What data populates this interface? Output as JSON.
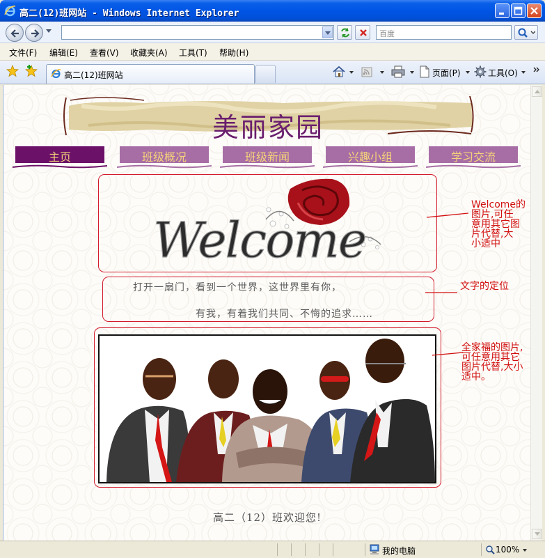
{
  "window": {
    "title": "高二(12)班网站 - Windows Internet Explorer"
  },
  "toolbar": {
    "address": "",
    "search_placeholder": "百度"
  },
  "menu": {
    "items": [
      "文件(F)",
      "编辑(E)",
      "查看(V)",
      "收藏夹(A)",
      "工具(T)",
      "帮助(H)"
    ]
  },
  "tab": {
    "label": "高二(12)班网站"
  },
  "commands": {
    "page": "页面(P)",
    "tools": "工具(O)"
  },
  "page": {
    "banner_title": "美丽家园",
    "nav": [
      "主页",
      "班级概况",
      "班级新闻",
      "兴趣小组",
      "学习交流"
    ],
    "welcome_word": "Welcome",
    "quote_line1": "打开一扇门，看到一个世界，这世界里有你，",
    "quote_line2": "有我，有着我们共同、不悔的追求……",
    "footer": "高二（12）班欢迎您!",
    "annotations": {
      "welcome": [
        "Welcome的",
        "图片,可任",
        "意用其它图",
        "片代替,大",
        "小适中"
      ],
      "text_position": "文字的定位",
      "group_photo": [
        "全家福的图片,",
        "可任意用其它",
        "图片代替,大小",
        "适中。"
      ]
    }
  },
  "status": {
    "zone": "我的电脑",
    "zoom": "100%"
  },
  "colors": {
    "nav_active": "#6c1168",
    "nav_inactive": "#a76ea5",
    "nav_text": "#f2d27a",
    "box_border": "#d21c2c",
    "annotation": "#d10f0f",
    "banner_text": "#6a1f6e"
  }
}
